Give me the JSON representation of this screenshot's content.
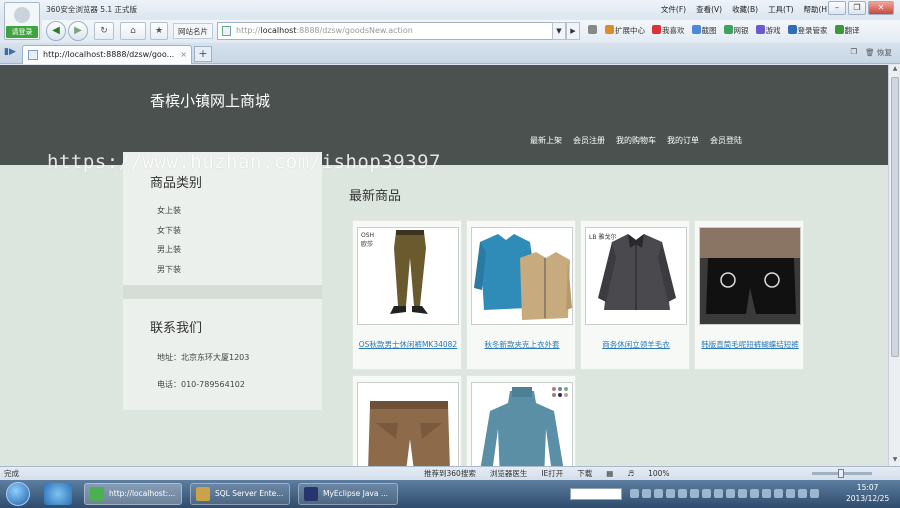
{
  "browser": {
    "app_title": "360安全浏览器 5.1 正式版",
    "login_label": "请登录",
    "menus": [
      "文件(F)",
      "查看(V)",
      "收藏(B)",
      "工具(T)",
      "帮助(H)"
    ],
    "favorites_label": "网站名片",
    "address_prefix": "http://",
    "address_host": "localhost",
    "address_rest": ":8888/dzsw/goodsNew.action",
    "toolbar_items": [
      "扩展中心",
      "我喜欢",
      "截图",
      "网银",
      "游戏",
      "登录管家",
      "翻译"
    ],
    "tab_title": "http://localhost:8888/dzsw/goo...",
    "tab_right_label": "恢复"
  },
  "site": {
    "title": "香槟小镇网上商城",
    "nav": [
      "最新上架",
      "会员注册",
      "我的购物车",
      "我的订单",
      "会员登陆"
    ]
  },
  "sidebar": {
    "categories_heading": "商品类别",
    "categories": [
      "女上装",
      "女下装",
      "男上装",
      "男下装"
    ],
    "contact_heading": "联系我们",
    "address_line": "地址：北京东环大厦1203",
    "phone_line": "电话：010-789564102"
  },
  "main": {
    "heading": "最新商品",
    "products": [
      {
        "name": "OS秋款男士休闲裤MK34082",
        "badge": "OSH 欧莎"
      },
      {
        "name": "秋冬新款夹克上衣外套",
        "badge": ""
      },
      {
        "name": "商务休闲立领羊毛衣",
        "badge": "LB 雅戈尔"
      },
      {
        "name": "韩版直筒毛呢短裤蝴蝶结短裤",
        "badge": ""
      },
      {
        "name": "",
        "badge": ""
      },
      {
        "name": "",
        "badge": ""
      }
    ]
  },
  "watermark": "https://www.huzhan.com/ishop39397",
  "statusbar": {
    "left": "完成",
    "items": [
      "推荐到360搜索",
      "浏览器医生",
      "IE打开",
      "下载"
    ],
    "zoom": "100%"
  },
  "taskbar": {
    "tasks": [
      "http://localhost:...",
      "SQL Server Ente...",
      "MyEclipse Java ..."
    ],
    "time": "15:07",
    "date": "2013/12/25"
  }
}
